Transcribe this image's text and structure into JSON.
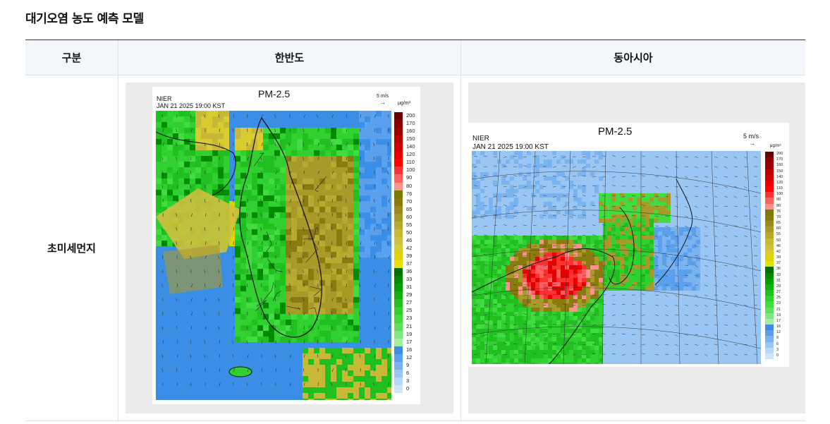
{
  "page": {
    "title": "대기오염 농도 예측 모델"
  },
  "table": {
    "headers": [
      "구분",
      "한반도",
      "동아시아"
    ],
    "rows": [
      {
        "label": "초미세먼지"
      }
    ]
  },
  "maps": {
    "korea": {
      "org": "NIER",
      "title": "PM-2.5",
      "timestamp": "JAN 21 2025 19:00 KST",
      "wind_ref": "5 m/s",
      "wind_arrow": "→",
      "unit": "μg/m³"
    },
    "east_asia": {
      "org": "NIER",
      "title": "PM-2.5",
      "timestamp": "JAN 21 2025 19:00 KST",
      "wind_ref": "5 m/s",
      "wind_arrow": "→",
      "unit": "μg/m³"
    }
  },
  "legend": {
    "levels": [
      "200",
      "170",
      "160",
      "150",
      "140",
      "120",
      "110",
      "100",
      "90",
      "80",
      "76",
      "70",
      "65",
      "60",
      "55",
      "50",
      "46",
      "42",
      "39",
      "37",
      "36",
      "33",
      "31",
      "29",
      "27",
      "25",
      "23",
      "21",
      "19",
      "17",
      "16",
      "12",
      "9",
      "6",
      "3",
      "0"
    ],
    "colors": [
      "#6b0000",
      "#8b0000",
      "#a00000",
      "#b80000",
      "#d00000",
      "#e80000",
      "#ff0000",
      "#ff3030",
      "#ff6060",
      "#ff9090",
      "#7a7a00",
      "#8a7a10",
      "#9a8a20",
      "#a89a28",
      "#b8aa30",
      "#c8b838",
      "#d0c040",
      "#d8cc30",
      "#e0d400",
      "#e8e000",
      "#007000",
      "#008a00",
      "#00a000",
      "#10b010",
      "#20c020",
      "#30d030",
      "#40dc40",
      "#60e060",
      "#80e880",
      "#a0f0a0",
      "#3a8ee6",
      "#5aa0ec",
      "#7ab4f0",
      "#9ac6f4",
      "#b8d6f6",
      "#d0e4f8"
    ]
  }
}
